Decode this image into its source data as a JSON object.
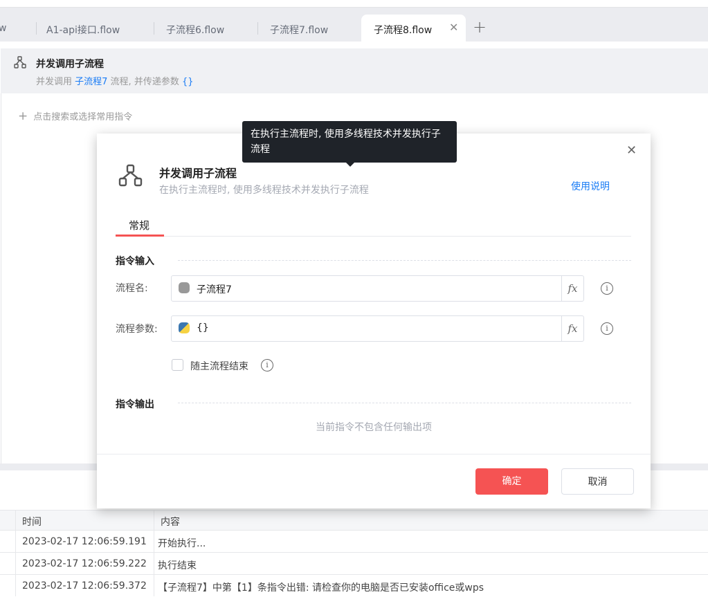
{
  "tabs": [
    {
      "label": "w"
    },
    {
      "label": "A1-api接口.flow"
    },
    {
      "label": "子流程6.flow"
    },
    {
      "label": "子流程7.flow"
    },
    {
      "label": "子流程8.flow",
      "active": true
    }
  ],
  "step": {
    "title": "并发调用子流程",
    "desc_prefix": "并发调用 ",
    "flow_link": "子流程7",
    "desc_mid": " 流程, 并传递参数 ",
    "param_link": "{}"
  },
  "add_command": "点击搜索或选择常用指令",
  "tooltip": "在执行主流程时, 使用多线程技术并发执行子流程",
  "modal": {
    "title": "并发调用子流程",
    "subtitle": "在执行主流程时, 使用多线程技术并发执行子流程",
    "help_link": "使用说明",
    "tab": "常规",
    "input_section": "指令输入",
    "fields": [
      {
        "label": "流程名:",
        "value": "子流程7"
      },
      {
        "label": "流程参数:",
        "value": "{}"
      }
    ],
    "fx": "fx",
    "checkbox_label": "随主流程结束",
    "checkbox_checked": false,
    "output_section": "指令输出",
    "output_empty": "当前指令不包含任何输出项",
    "ok": "确定",
    "cancel": "取消"
  },
  "log": {
    "columns": [
      "时间",
      "内容"
    ],
    "rows": [
      {
        "time": "2023-02-17 12:06:59.191",
        "content": "开始执行..."
      },
      {
        "time": "2023-02-17 12:06:59.222",
        "content": "执行结束"
      },
      {
        "time": "2023-02-17 12:06:59.372",
        "content": "【子流程7】中第【1】条指令出错: 请检查你的电脑是否已安装office或wps"
      }
    ]
  },
  "colors": {
    "accent": "#f55353",
    "link": "#1a7cf5",
    "tooltip_bg": "#1f2329"
  }
}
